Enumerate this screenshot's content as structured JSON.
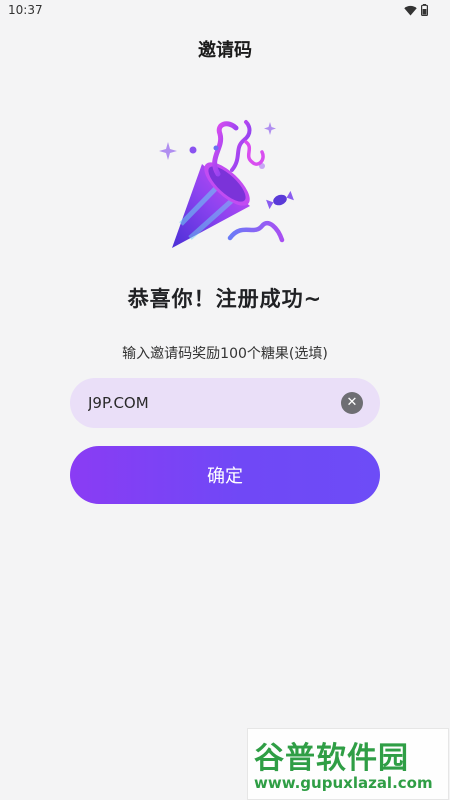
{
  "status_bar": {
    "time": "10:37",
    "wifi_icon": "wifi-icon",
    "battery_icon": "battery-icon"
  },
  "header": {
    "title": "邀请码"
  },
  "illustration": {
    "icon": "party-popper-icon"
  },
  "main": {
    "headline": "恭喜你！注册成功~",
    "subtitle": "输入邀请码奖励100个糖果(选填)",
    "invite_input": {
      "value": "J9P.COM",
      "clear_icon": "clear-icon"
    },
    "confirm_label": "确定"
  },
  "watermark": {
    "logo_text": "谷普软件园",
    "url": "www.gupuxlazal.com"
  },
  "colors": {
    "background": "#f4f4f5",
    "input_bg": "#eadff8",
    "button_gradient_start": "#8a3cf4",
    "button_gradient_end": "#6d4cf7",
    "watermark_green": "#2f9e45"
  }
}
